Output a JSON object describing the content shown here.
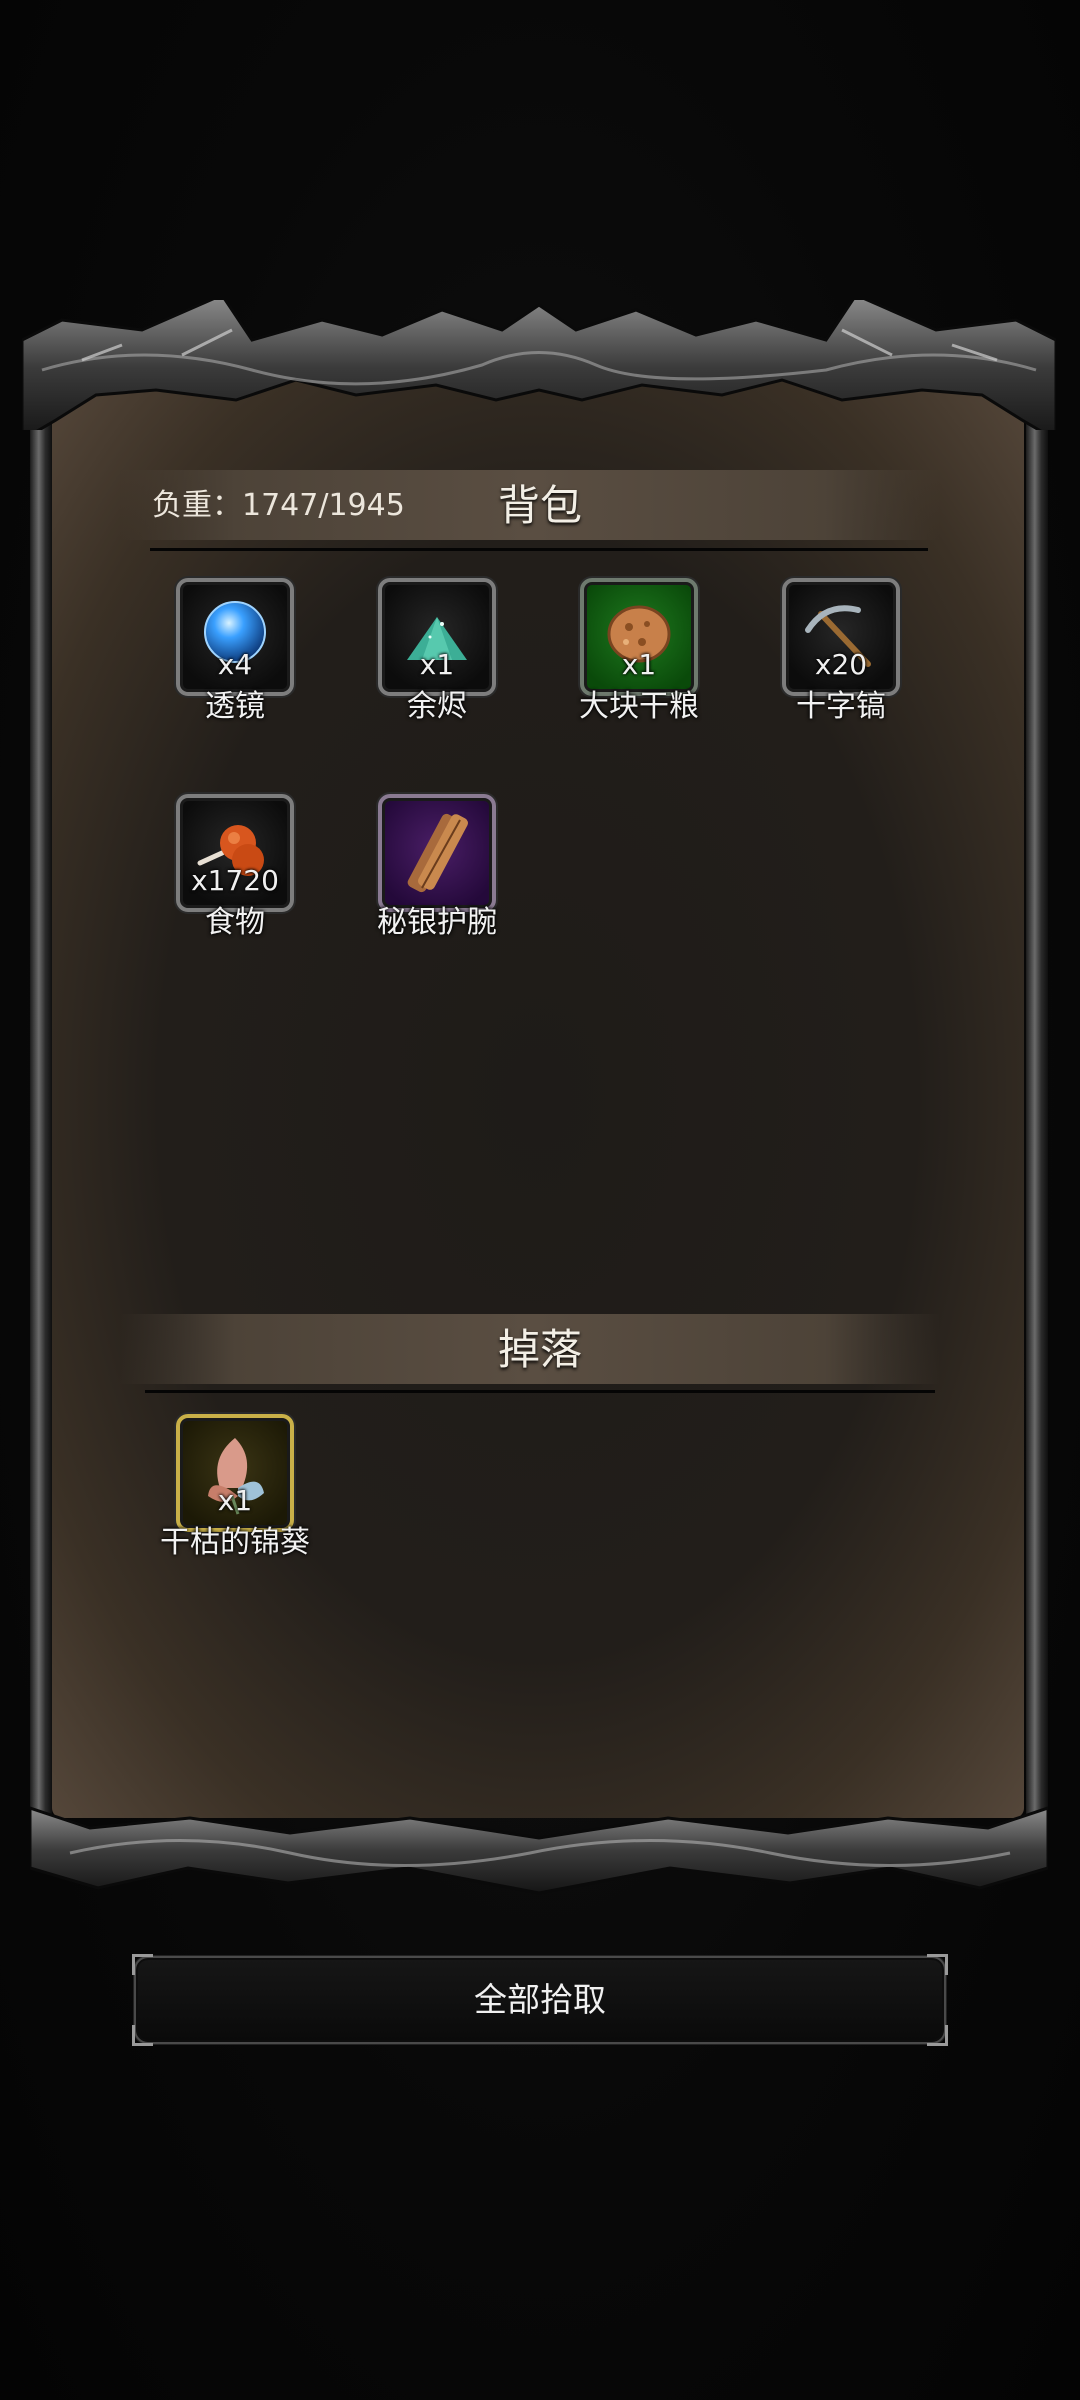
{
  "backpack": {
    "weight_label": "负重：1747/1945",
    "title": "背包",
    "items": [
      {
        "name": "透镜",
        "qty": "x4",
        "rarity": "grey",
        "icon": "lens-orb-icon"
      },
      {
        "name": "余烬",
        "qty": "x1",
        "rarity": "grey",
        "icon": "ember-pile-icon"
      },
      {
        "name": "大块干粮",
        "qty": "x1",
        "rarity": "green",
        "icon": "dry-ration-icon"
      },
      {
        "name": "十字镐",
        "qty": "x20",
        "rarity": "grey",
        "icon": "pickaxe-icon"
      },
      {
        "name": "食物",
        "qty": "x1720",
        "rarity": "grey",
        "icon": "meat-drumstick-icon"
      },
      {
        "name": "秘银护腕",
        "qty": "",
        "rarity": "purple",
        "icon": "mithril-bracer-icon"
      }
    ]
  },
  "drops": {
    "title": "掉落",
    "items": [
      {
        "name": "干枯的锦葵",
        "qty": "x1",
        "rarity": "gold",
        "icon": "withered-mallow-icon"
      }
    ]
  },
  "actions": {
    "pick_all_label": "全部拾取"
  },
  "colors": {
    "rarity_grey": "#7d7d7d",
    "rarity_green": "#1f7a1f",
    "rarity_purple": "#4a1e66",
    "rarity_gold": "#c9b048"
  }
}
